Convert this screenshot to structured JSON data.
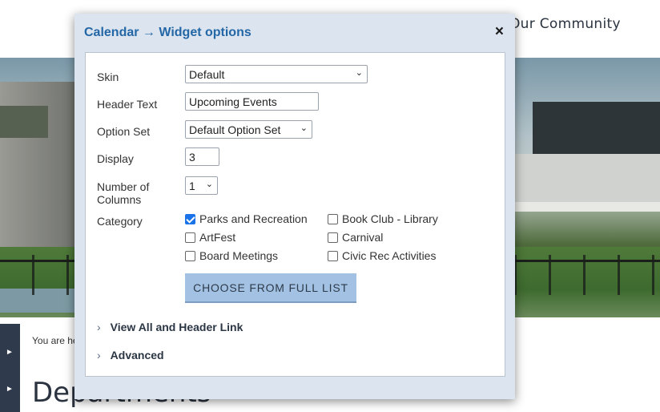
{
  "background": {
    "nav_text": "Our Community",
    "breadcrumb": "You are he",
    "heading": "Departments",
    "side_arrows": [
      "►",
      "►"
    ]
  },
  "modal": {
    "title": "Calendar → Widget options",
    "close_icon": "×",
    "fields": {
      "skin_label": "Skin",
      "skin_value": "Default",
      "header_text_label": "Header Text",
      "header_text_value": "Upcoming Events",
      "option_set_label": "Option Set",
      "option_set_value": "Default Option Set",
      "display_label": "Display",
      "display_value": "3",
      "columns_label_1": "Number of",
      "columns_label_2": "Columns",
      "columns_value": "1",
      "category_label": "Category"
    },
    "categories": [
      {
        "label": "Parks and Recreation",
        "checked": true
      },
      {
        "label": "Book Club - Library",
        "checked": false
      },
      {
        "label": "ArtFest",
        "checked": false
      },
      {
        "label": "Carnival",
        "checked": false
      },
      {
        "label": "Board Meetings",
        "checked": false
      },
      {
        "label": "Civic Rec Activities",
        "checked": false
      }
    ],
    "choose_button": "CHOOSE FROM FULL LIST",
    "sections": {
      "view_all": "View All and Header Link",
      "advanced": "Advanced"
    },
    "chevron_icon": "›",
    "caret_icon": "⌄"
  },
  "colors": {
    "modal_bg": "#dbe4ef",
    "title": "#2467a6",
    "button_bg": "#a3c2e3",
    "checkbox_checked": "#1a73e8"
  }
}
